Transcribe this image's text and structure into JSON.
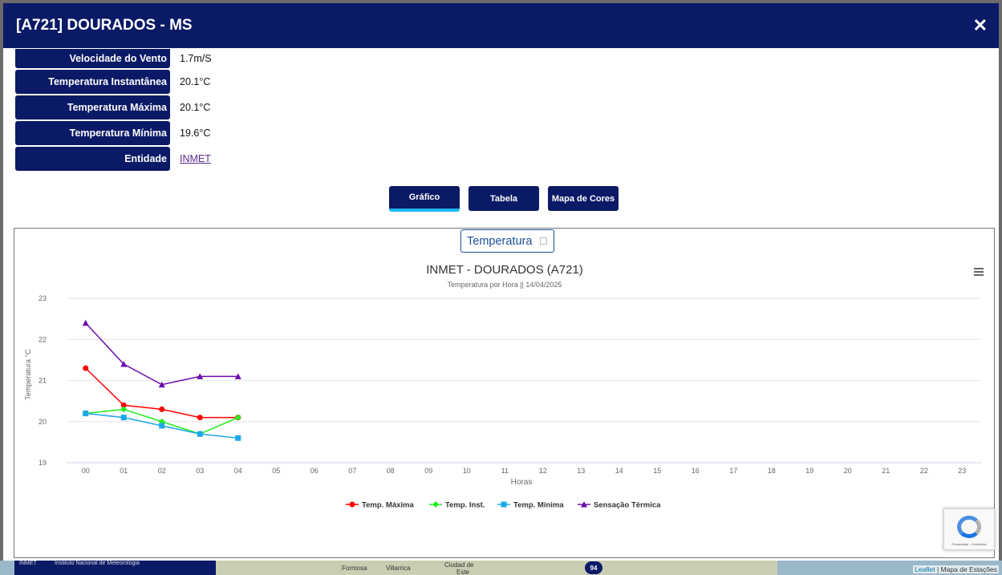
{
  "modal": {
    "title": "[A721] DOURADOS - MS",
    "close_label": "✕"
  },
  "info": [
    {
      "label": "Velocidade do Vento",
      "value": "1.7m/S"
    },
    {
      "label": "Temperatura Instantânea",
      "value": "20.1°C"
    },
    {
      "label": "Temperatura Máxima",
      "value": "20.1°C"
    },
    {
      "label": "Temperatura Mínima",
      "value": "19.6°C"
    },
    {
      "label": "Entidade",
      "value": "INMET"
    }
  ],
  "tabs": [
    {
      "label": "Gráfico",
      "active": true
    },
    {
      "label": "Tabela",
      "active": false
    },
    {
      "label": "Mapa de Cores",
      "active": false
    }
  ],
  "series_select": {
    "value": "Temperatura"
  },
  "menu_icon": "hamburger-menu-icon",
  "chart_data": {
    "type": "line",
    "title": "INMET - DOURADOS (A721)",
    "subtitle": "Temperatura por Hora || 14/04/2025",
    "xlabel": "Horas",
    "ylabel": "Temperatura °C",
    "categories": [
      "00",
      "01",
      "02",
      "03",
      "04",
      "05",
      "06",
      "07",
      "08",
      "09",
      "10",
      "11",
      "12",
      "13",
      "14",
      "15",
      "16",
      "17",
      "18",
      "19",
      "20",
      "21",
      "22",
      "23"
    ],
    "ylim": [
      19,
      23
    ],
    "yticks": [
      19,
      20,
      21,
      22,
      23
    ],
    "grid": true,
    "legend_position": "bottom-center",
    "series": [
      {
        "name": "Temp. Máxima",
        "color": "#ff0000",
        "marker": "circle",
        "values": [
          21.3,
          20.4,
          20.3,
          20.1,
          20.1
        ]
      },
      {
        "name": "Temp. Inst.",
        "color": "#22ee22",
        "marker": "diamond",
        "values": [
          20.2,
          20.3,
          20.0,
          19.7,
          20.1
        ]
      },
      {
        "name": "Temp. Mínima",
        "color": "#1ea8e8",
        "marker": "square",
        "values": [
          20.2,
          20.1,
          19.9,
          19.7,
          19.6
        ]
      },
      {
        "name": "Sensação Térmica",
        "color": "#6a0dad",
        "marker": "triangle",
        "values": [
          22.4,
          21.4,
          20.9,
          21.1,
          21.1
        ]
      }
    ]
  },
  "footer": {
    "org_short": "INMET",
    "org_name": "Instituto Nacional de Meteorologia",
    "map_labels": [
      "Formosa",
      "Villarrica",
      "Ciudad de",
      "Este"
    ],
    "clusters": [
      "94"
    ],
    "attribution_leaflet": "Leaflet",
    "attribution_rest": " | Mapa de Estações"
  },
  "colors": {
    "navy": "#0b1a66",
    "accent": "#1bb7f0",
    "select_blue": "#1a4f9a"
  }
}
